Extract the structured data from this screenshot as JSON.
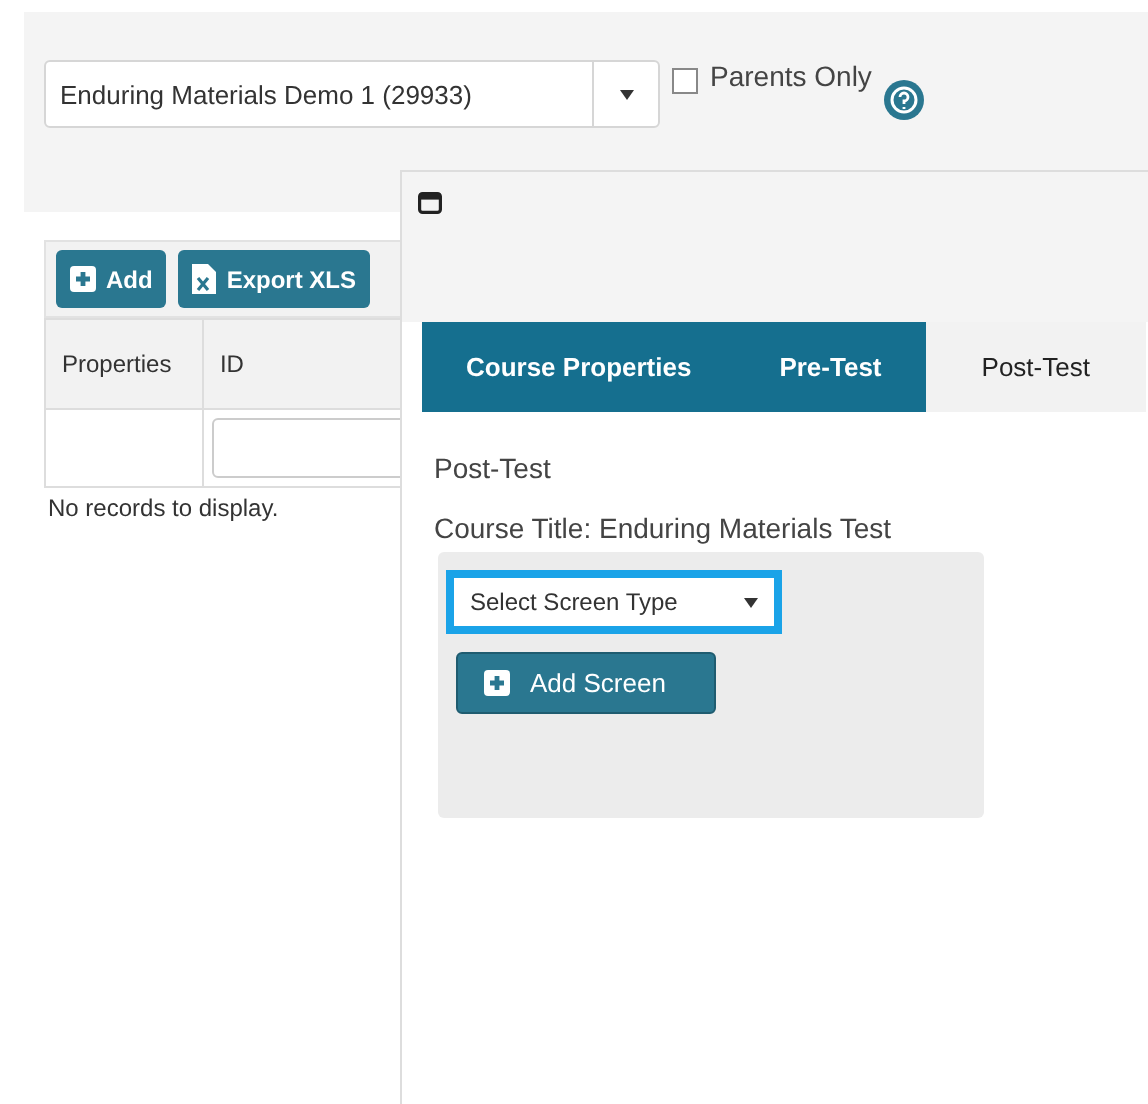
{
  "course_select": {
    "value": "Enduring Materials Demo 1 (29933)"
  },
  "parents_only": {
    "label": "Parents Only",
    "checked": false
  },
  "toolbar": {
    "buttons": [
      {
        "label": "Add",
        "kind": "add"
      },
      {
        "label": "Export XLS",
        "kind": "export"
      }
    ]
  },
  "table": {
    "columns": [
      "Properties",
      "ID"
    ],
    "empty_message": "No records to display."
  },
  "dialog": {
    "tabs": [
      {
        "label": "Course Properties",
        "selected": false
      },
      {
        "label": "Pre-Test",
        "selected": false
      },
      {
        "label": "Post-Test",
        "selected": true
      }
    ],
    "heading": "Post-Test",
    "course_title": "Course Title: Enduring Materials Test",
    "screen_type_select": {
      "value": "Select Screen Type"
    },
    "add_screen_button": "Add Screen"
  }
}
